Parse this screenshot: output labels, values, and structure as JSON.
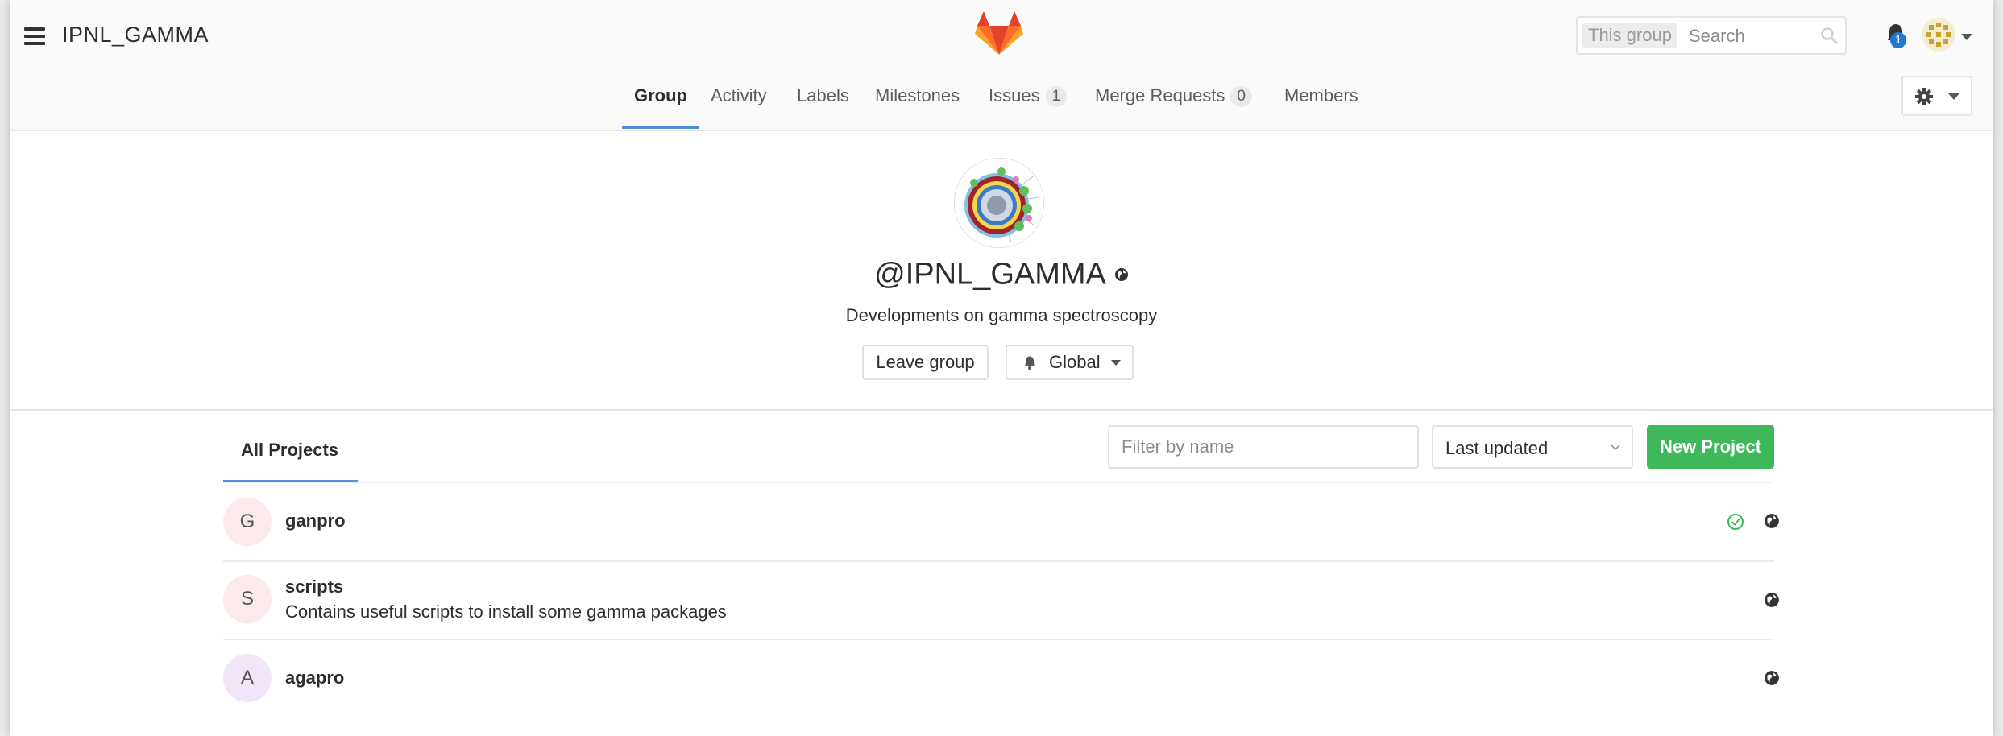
{
  "header": {
    "title": "IPNL_GAMMA",
    "search": {
      "scope": "This group",
      "placeholder": "Search"
    },
    "notifications": {
      "count": "1"
    }
  },
  "nav": {
    "items": [
      {
        "label": "Group",
        "active": true
      },
      {
        "label": "Activity"
      },
      {
        "label": "Labels"
      },
      {
        "label": "Milestones"
      },
      {
        "label": "Issues",
        "count": "1"
      },
      {
        "label": "Merge Requests",
        "count": "0"
      },
      {
        "label": "Members"
      }
    ]
  },
  "group": {
    "handle": "@IPNL_GAMMA",
    "description": "Developments on gamma spectroscopy",
    "leave_label": "Leave group",
    "notification_label": "Global"
  },
  "projects": {
    "tab_label": "All Projects",
    "filter_placeholder": "Filter by name",
    "sort_label": "Last updated",
    "new_label": "New Project",
    "items": [
      {
        "initial": "G",
        "name": "ganpro",
        "description": "",
        "avatar_color": "#fbe9eb",
        "pipeline": "passed",
        "visibility": "public"
      },
      {
        "initial": "S",
        "name": "scripts",
        "description": "Contains useful scripts to install some gamma packages",
        "avatar_color": "#fbe9eb",
        "visibility": "public"
      },
      {
        "initial": "A",
        "name": "agapro",
        "description": "",
        "avatar_color": "#f0e6f8",
        "visibility": "public"
      }
    ]
  },
  "colors": {
    "accent": "#4a90e2",
    "success": "#3fb85b",
    "notification_badge": "#1f78d1",
    "gitlab_orange": "#fc6d26"
  }
}
